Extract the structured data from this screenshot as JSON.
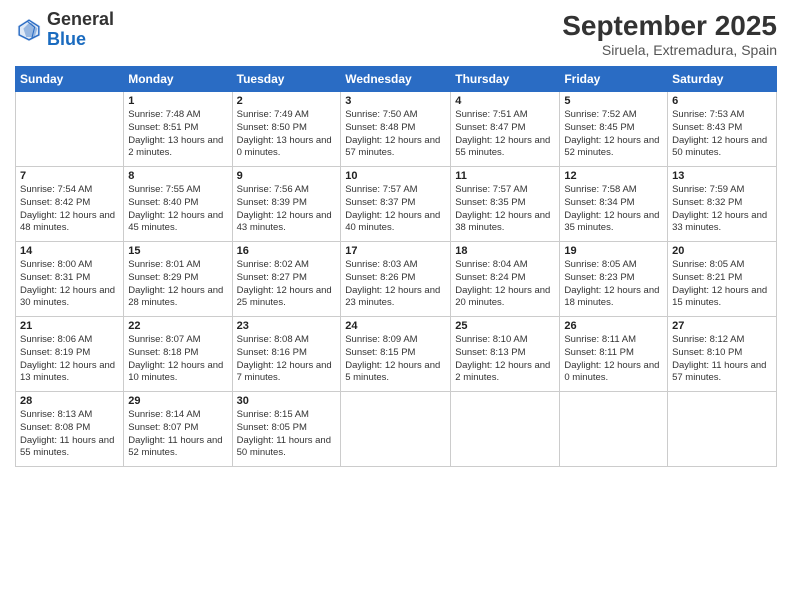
{
  "header": {
    "logo_text_general": "General",
    "logo_text_blue": "Blue",
    "month_title": "September 2025",
    "location": "Siruela, Extremadura, Spain"
  },
  "calendar": {
    "days_of_week": [
      "Sunday",
      "Monday",
      "Tuesday",
      "Wednesday",
      "Thursday",
      "Friday",
      "Saturday"
    ],
    "weeks": [
      [
        {
          "day": "",
          "sunrise": "",
          "sunset": "",
          "daylight": ""
        },
        {
          "day": "1",
          "sunrise": "Sunrise: 7:48 AM",
          "sunset": "Sunset: 8:51 PM",
          "daylight": "Daylight: 13 hours and 2 minutes."
        },
        {
          "day": "2",
          "sunrise": "Sunrise: 7:49 AM",
          "sunset": "Sunset: 8:50 PM",
          "daylight": "Daylight: 13 hours and 0 minutes."
        },
        {
          "day": "3",
          "sunrise": "Sunrise: 7:50 AM",
          "sunset": "Sunset: 8:48 PM",
          "daylight": "Daylight: 12 hours and 57 minutes."
        },
        {
          "day": "4",
          "sunrise": "Sunrise: 7:51 AM",
          "sunset": "Sunset: 8:47 PM",
          "daylight": "Daylight: 12 hours and 55 minutes."
        },
        {
          "day": "5",
          "sunrise": "Sunrise: 7:52 AM",
          "sunset": "Sunset: 8:45 PM",
          "daylight": "Daylight: 12 hours and 52 minutes."
        },
        {
          "day": "6",
          "sunrise": "Sunrise: 7:53 AM",
          "sunset": "Sunset: 8:43 PM",
          "daylight": "Daylight: 12 hours and 50 minutes."
        }
      ],
      [
        {
          "day": "7",
          "sunrise": "Sunrise: 7:54 AM",
          "sunset": "Sunset: 8:42 PM",
          "daylight": "Daylight: 12 hours and 48 minutes."
        },
        {
          "day": "8",
          "sunrise": "Sunrise: 7:55 AM",
          "sunset": "Sunset: 8:40 PM",
          "daylight": "Daylight: 12 hours and 45 minutes."
        },
        {
          "day": "9",
          "sunrise": "Sunrise: 7:56 AM",
          "sunset": "Sunset: 8:39 PM",
          "daylight": "Daylight: 12 hours and 43 minutes."
        },
        {
          "day": "10",
          "sunrise": "Sunrise: 7:57 AM",
          "sunset": "Sunset: 8:37 PM",
          "daylight": "Daylight: 12 hours and 40 minutes."
        },
        {
          "day": "11",
          "sunrise": "Sunrise: 7:57 AM",
          "sunset": "Sunset: 8:35 PM",
          "daylight": "Daylight: 12 hours and 38 minutes."
        },
        {
          "day": "12",
          "sunrise": "Sunrise: 7:58 AM",
          "sunset": "Sunset: 8:34 PM",
          "daylight": "Daylight: 12 hours and 35 minutes."
        },
        {
          "day": "13",
          "sunrise": "Sunrise: 7:59 AM",
          "sunset": "Sunset: 8:32 PM",
          "daylight": "Daylight: 12 hours and 33 minutes."
        }
      ],
      [
        {
          "day": "14",
          "sunrise": "Sunrise: 8:00 AM",
          "sunset": "Sunset: 8:31 PM",
          "daylight": "Daylight: 12 hours and 30 minutes."
        },
        {
          "day": "15",
          "sunrise": "Sunrise: 8:01 AM",
          "sunset": "Sunset: 8:29 PM",
          "daylight": "Daylight: 12 hours and 28 minutes."
        },
        {
          "day": "16",
          "sunrise": "Sunrise: 8:02 AM",
          "sunset": "Sunset: 8:27 PM",
          "daylight": "Daylight: 12 hours and 25 minutes."
        },
        {
          "day": "17",
          "sunrise": "Sunrise: 8:03 AM",
          "sunset": "Sunset: 8:26 PM",
          "daylight": "Daylight: 12 hours and 23 minutes."
        },
        {
          "day": "18",
          "sunrise": "Sunrise: 8:04 AM",
          "sunset": "Sunset: 8:24 PM",
          "daylight": "Daylight: 12 hours and 20 minutes."
        },
        {
          "day": "19",
          "sunrise": "Sunrise: 8:05 AM",
          "sunset": "Sunset: 8:23 PM",
          "daylight": "Daylight: 12 hours and 18 minutes."
        },
        {
          "day": "20",
          "sunrise": "Sunrise: 8:05 AM",
          "sunset": "Sunset: 8:21 PM",
          "daylight": "Daylight: 12 hours and 15 minutes."
        }
      ],
      [
        {
          "day": "21",
          "sunrise": "Sunrise: 8:06 AM",
          "sunset": "Sunset: 8:19 PM",
          "daylight": "Daylight: 12 hours and 13 minutes."
        },
        {
          "day": "22",
          "sunrise": "Sunrise: 8:07 AM",
          "sunset": "Sunset: 8:18 PM",
          "daylight": "Daylight: 12 hours and 10 minutes."
        },
        {
          "day": "23",
          "sunrise": "Sunrise: 8:08 AM",
          "sunset": "Sunset: 8:16 PM",
          "daylight": "Daylight: 12 hours and 7 minutes."
        },
        {
          "day": "24",
          "sunrise": "Sunrise: 8:09 AM",
          "sunset": "Sunset: 8:15 PM",
          "daylight": "Daylight: 12 hours and 5 minutes."
        },
        {
          "day": "25",
          "sunrise": "Sunrise: 8:10 AM",
          "sunset": "Sunset: 8:13 PM",
          "daylight": "Daylight: 12 hours and 2 minutes."
        },
        {
          "day": "26",
          "sunrise": "Sunrise: 8:11 AM",
          "sunset": "Sunset: 8:11 PM",
          "daylight": "Daylight: 12 hours and 0 minutes."
        },
        {
          "day": "27",
          "sunrise": "Sunrise: 8:12 AM",
          "sunset": "Sunset: 8:10 PM",
          "daylight": "Daylight: 11 hours and 57 minutes."
        }
      ],
      [
        {
          "day": "28",
          "sunrise": "Sunrise: 8:13 AM",
          "sunset": "Sunset: 8:08 PM",
          "daylight": "Daylight: 11 hours and 55 minutes."
        },
        {
          "day": "29",
          "sunrise": "Sunrise: 8:14 AM",
          "sunset": "Sunset: 8:07 PM",
          "daylight": "Daylight: 11 hours and 52 minutes."
        },
        {
          "day": "30",
          "sunrise": "Sunrise: 8:15 AM",
          "sunset": "Sunset: 8:05 PM",
          "daylight": "Daylight: 11 hours and 50 minutes."
        },
        {
          "day": "",
          "sunrise": "",
          "sunset": "",
          "daylight": ""
        },
        {
          "day": "",
          "sunrise": "",
          "sunset": "",
          "daylight": ""
        },
        {
          "day": "",
          "sunrise": "",
          "sunset": "",
          "daylight": ""
        },
        {
          "day": "",
          "sunrise": "",
          "sunset": "",
          "daylight": ""
        }
      ]
    ]
  }
}
